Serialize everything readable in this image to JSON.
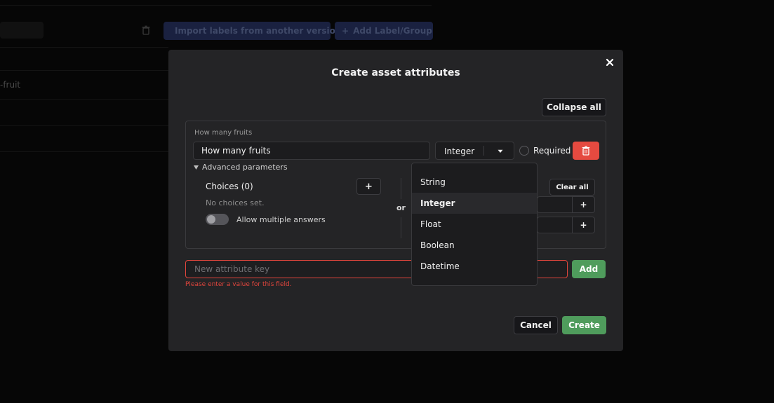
{
  "background": {
    "toolbar": {
      "import_label": "Import labels from another version",
      "add_label": "Add Label/Group"
    },
    "row_text": "-fruit"
  },
  "modal": {
    "title": "Create asset attributes",
    "collapse_all_label": "Collapse all",
    "attribute": {
      "caption": "How many fruits",
      "key_value": "How many fruits",
      "type_value": "Integer",
      "required_label": "Required",
      "advanced_label": "Advanced parameters",
      "choices_label": "Choices (0)",
      "add_choice_label": "+",
      "no_choices_text": "No choices set.",
      "allow_multiple_label": "Allow multiple answers",
      "or_label": "or",
      "clear_all_label": "Clear all",
      "min_add_label": "+",
      "max_add_label": "+"
    },
    "new_key": {
      "placeholder": "New attribute key",
      "error": "Please enter a value for this field.",
      "add_label": "Add"
    },
    "footer": {
      "cancel_label": "Cancel",
      "create_label": "Create"
    }
  },
  "type_dropdown": {
    "options": [
      "String",
      "Integer",
      "Float",
      "Boolean",
      "Datetime"
    ],
    "selected": "Integer"
  },
  "colors": {
    "accent_green": "#4f9c5c",
    "danger_red": "#e54a40",
    "error_red": "#e0453c"
  }
}
